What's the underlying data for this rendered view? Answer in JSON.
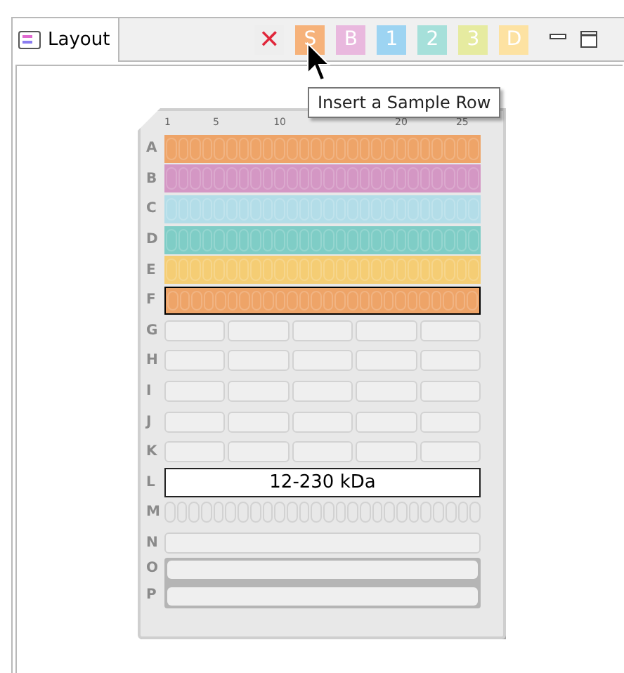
{
  "tab": {
    "label": "Layout",
    "selected": true
  },
  "toolbar": [
    {
      "kind": "delete",
      "label": "✕"
    },
    {
      "kind": "letter",
      "label": "S",
      "color": "#f6b27a"
    },
    {
      "kind": "letter",
      "label": "B",
      "color": "#e9b8de"
    },
    {
      "kind": "letter",
      "label": "1",
      "color": "#9dd4f2"
    },
    {
      "kind": "letter",
      "label": "2",
      "color": "#a6e0da"
    },
    {
      "kind": "letter",
      "label": "3",
      "color": "#e6eba0"
    },
    {
      "kind": "letter",
      "label": "D",
      "color": "#fde2a2"
    }
  ],
  "tooltip": "Insert a Sample Row",
  "plate": {
    "column_labels": [
      "1",
      "5",
      "10",
      "20",
      "25"
    ],
    "rows": [
      {
        "label": "A",
        "kind": "filled",
        "color": "#eea468",
        "selected": false
      },
      {
        "label": "B",
        "kind": "filled",
        "color": "#d497c4",
        "selected": false
      },
      {
        "label": "C",
        "kind": "filled",
        "color": "#b3dde8",
        "selected": false
      },
      {
        "label": "D",
        "kind": "filled",
        "color": "#7fcdc6",
        "selected": false
      },
      {
        "label": "E",
        "kind": "filled",
        "color": "#f5cd74",
        "selected": false
      },
      {
        "label": "F",
        "kind": "filled",
        "color": "#eea468",
        "selected": true
      },
      {
        "label": "G",
        "kind": "segments"
      },
      {
        "label": "H",
        "kind": "segments"
      },
      {
        "label": "I",
        "kind": "segments"
      },
      {
        "label": "J",
        "kind": "segments"
      },
      {
        "label": "K",
        "kind": "segments"
      },
      {
        "label": "L",
        "kind": "text",
        "text": "12-230 kDa"
      },
      {
        "label": "M",
        "kind": "wells"
      },
      {
        "label": "N",
        "kind": "bar",
        "grouped": false
      },
      {
        "label": "O",
        "kind": "bar",
        "grouped": true
      },
      {
        "label": "P",
        "kind": "bar",
        "grouped": true
      }
    ]
  }
}
